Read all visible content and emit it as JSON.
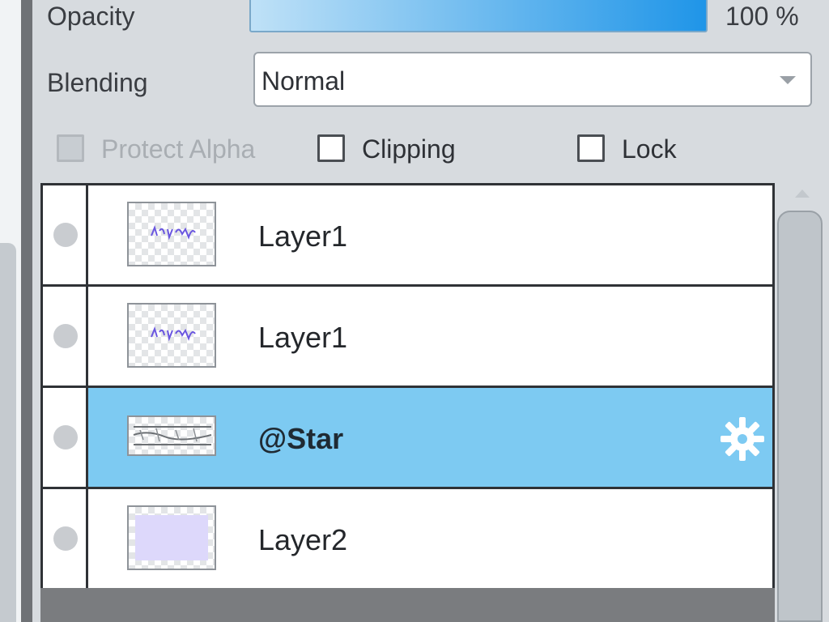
{
  "opacity": {
    "label": "Opacity",
    "value_text": "100 %",
    "value_percent": 100
  },
  "blending": {
    "label": "Blending",
    "selected": "Normal"
  },
  "options": {
    "protect_alpha": {
      "label": "Protect Alpha",
      "checked": false,
      "enabled": false
    },
    "clipping": {
      "label": "Clipping",
      "checked": false,
      "enabled": true
    },
    "lock": {
      "label": "Lock",
      "checked": false,
      "enabled": true
    }
  },
  "layers": [
    {
      "name": "Layer1",
      "selected": false,
      "visible": false,
      "thumbnail": "scribble-icon"
    },
    {
      "name": "Layer1",
      "selected": false,
      "visible": false,
      "thumbnail": "scribble-icon"
    },
    {
      "name": "@Star",
      "selected": true,
      "visible": false,
      "thumbnail": "star-strip-icon",
      "has_settings": true
    },
    {
      "name": "Layer2",
      "selected": false,
      "visible": false,
      "thumbnail": "fill-icon"
    }
  ],
  "colors": {
    "selected_row": "#7dcaf2",
    "opacity_gradient_end": "#1f95e8"
  }
}
